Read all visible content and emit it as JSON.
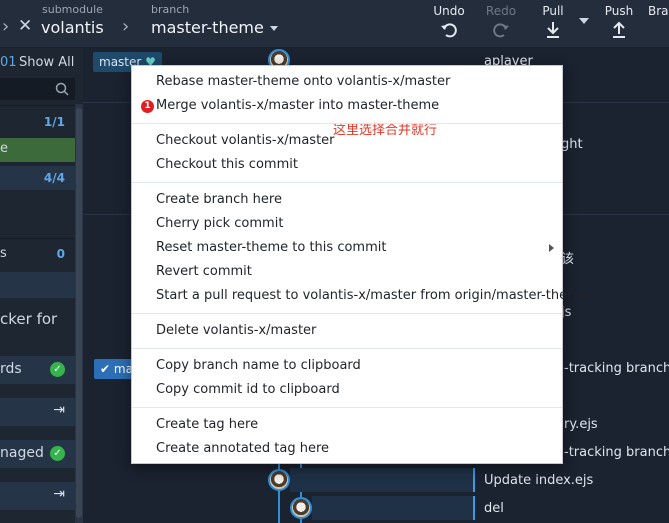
{
  "toolbar": {
    "repo_label": "submodule",
    "repo_name": "volantis",
    "branch_label": "branch",
    "branch_name": "master-theme",
    "undo": "Undo",
    "redo": "Redo",
    "pull": "Pull",
    "push": "Push",
    "branch_truncated": "Bra"
  },
  "left": {
    "show_all": "Show All",
    "tag_01": "01",
    "rows": [
      {
        "count": "1/1"
      },
      {
        "label": "e"
      },
      {
        "count": "4/4"
      },
      {
        "label": "s",
        "count": "0"
      },
      {
        "label": "cker for"
      },
      {
        "label": "rds"
      },
      {
        "label": "naged"
      }
    ]
  },
  "graph": {
    "tags": {
      "master": "master",
      "ma": "ma"
    },
    "messages": {
      "top": "aplayer",
      "r2": "ght",
      "r3": "该",
      "r4": "js",
      "tracking1": "-tracking branch 'vo",
      "r5": "ry.ejs",
      "tracking2": "-tracking branch 'vo",
      "update": "Update index.ejs",
      "del": "del"
    }
  },
  "menu": {
    "items": [
      "Rebase master-theme onto volantis-x/master",
      "Merge volantis-x/master into master-theme",
      "Checkout volantis-x/master",
      "Checkout this commit",
      "Create branch here",
      "Cherry pick commit",
      "Reset master-theme to this commit",
      "Revert commit",
      "Start a pull request to volantis-x/master from origin/master-theme",
      "Delete volantis-x/master",
      "Copy branch name to clipboard",
      "Copy commit id to clipboard",
      "Create tag here",
      "Create annotated tag here"
    ],
    "badge": "1",
    "annotation": "这里选择合并就行"
  },
  "colors": {
    "accent": "#2f8fd8",
    "annotation": "#e03a2a",
    "success": "#37b24d"
  }
}
